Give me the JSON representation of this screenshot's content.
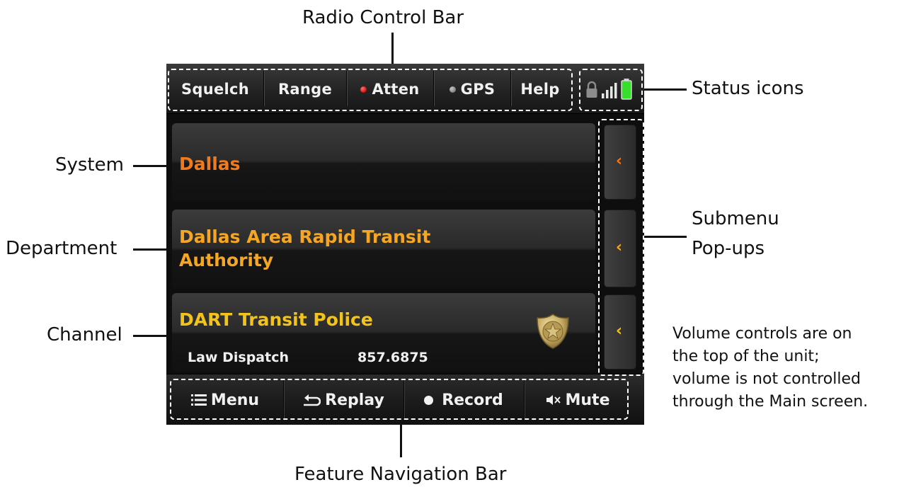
{
  "callouts": {
    "radio_control_bar": "Radio Control Bar",
    "status_icons": "Status icons",
    "system": "System",
    "department": "Department",
    "channel": "Channel",
    "submenu_line1": "Submenu",
    "submenu_line2": "Pop-ups",
    "volume_note": [
      "Volume controls are on",
      "the top of the unit;",
      "volume is not controlled",
      "through the Main screen."
    ],
    "feature_navigation_bar": "Feature Navigation Bar"
  },
  "radio_control_bar": {
    "squelch": "Squelch",
    "range": "Range",
    "atten": "Atten",
    "gps": "GPS",
    "help": "Help"
  },
  "status_icons": [
    "lock-icon",
    "signal-bars-icon",
    "battery-icon"
  ],
  "system": {
    "name": "Dallas"
  },
  "department": {
    "line1": "Dallas Area Rapid Transit",
    "line2": "Authority"
  },
  "channel": {
    "name": "DART Transit Police",
    "service_type": "Law Dispatch",
    "frequency": "857.6875",
    "icon": "police-badge-icon"
  },
  "submenu": {
    "chevron": "‹"
  },
  "feature_navigation_bar": {
    "menu": "Menu",
    "replay": "Replay",
    "record": "Record",
    "mute": "Mute"
  },
  "colors": {
    "system_text": "#f07a1c",
    "department_text": "#f5a623",
    "channel_text": "#f2c31b",
    "atten_dot": "#e01818",
    "gps_dot": "#8a8a8a",
    "battery": "#36e02a"
  }
}
